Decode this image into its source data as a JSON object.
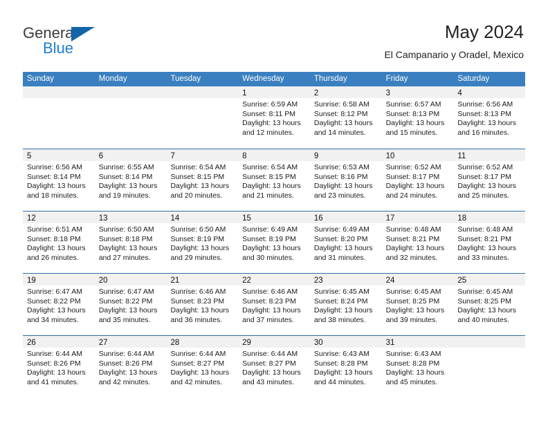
{
  "brand": {
    "name_top": "General",
    "name_bottom": "Blue",
    "flag_color": "#1464aa",
    "blue_text_color": "#1b7fd4"
  },
  "header": {
    "title": "May 2024",
    "subtitle": "El Campanario y Oradel, Mexico"
  },
  "theme": {
    "header_blue": "#3a7fbf",
    "row_divider_blue": "#2e6da4",
    "day_band_gray": "#f1f1f1"
  },
  "weekdays": [
    "Sunday",
    "Monday",
    "Tuesday",
    "Wednesday",
    "Thursday",
    "Friday",
    "Saturday"
  ],
  "weeks": [
    [
      {
        "day": "",
        "empty": true
      },
      {
        "day": "",
        "empty": true
      },
      {
        "day": "",
        "empty": true
      },
      {
        "day": "1",
        "sunrise": "Sunrise: 6:59 AM",
        "sunset": "Sunset: 8:11 PM",
        "daylight1": "Daylight: 13 hours",
        "daylight2": "and 12 minutes."
      },
      {
        "day": "2",
        "sunrise": "Sunrise: 6:58 AM",
        "sunset": "Sunset: 8:12 PM",
        "daylight1": "Daylight: 13 hours",
        "daylight2": "and 14 minutes."
      },
      {
        "day": "3",
        "sunrise": "Sunrise: 6:57 AM",
        "sunset": "Sunset: 8:13 PM",
        "daylight1": "Daylight: 13 hours",
        "daylight2": "and 15 minutes."
      },
      {
        "day": "4",
        "sunrise": "Sunrise: 6:56 AM",
        "sunset": "Sunset: 8:13 PM",
        "daylight1": "Daylight: 13 hours",
        "daylight2": "and 16 minutes."
      }
    ],
    [
      {
        "day": "5",
        "sunrise": "Sunrise: 6:56 AM",
        "sunset": "Sunset: 8:14 PM",
        "daylight1": "Daylight: 13 hours",
        "daylight2": "and 18 minutes."
      },
      {
        "day": "6",
        "sunrise": "Sunrise: 6:55 AM",
        "sunset": "Sunset: 8:14 PM",
        "daylight1": "Daylight: 13 hours",
        "daylight2": "and 19 minutes."
      },
      {
        "day": "7",
        "sunrise": "Sunrise: 6:54 AM",
        "sunset": "Sunset: 8:15 PM",
        "daylight1": "Daylight: 13 hours",
        "daylight2": "and 20 minutes."
      },
      {
        "day": "8",
        "sunrise": "Sunrise: 6:54 AM",
        "sunset": "Sunset: 8:15 PM",
        "daylight1": "Daylight: 13 hours",
        "daylight2": "and 21 minutes."
      },
      {
        "day": "9",
        "sunrise": "Sunrise: 6:53 AM",
        "sunset": "Sunset: 8:16 PM",
        "daylight1": "Daylight: 13 hours",
        "daylight2": "and 23 minutes."
      },
      {
        "day": "10",
        "sunrise": "Sunrise: 6:52 AM",
        "sunset": "Sunset: 8:17 PM",
        "daylight1": "Daylight: 13 hours",
        "daylight2": "and 24 minutes."
      },
      {
        "day": "11",
        "sunrise": "Sunrise: 6:52 AM",
        "sunset": "Sunset: 8:17 PM",
        "daylight1": "Daylight: 13 hours",
        "daylight2": "and 25 minutes."
      }
    ],
    [
      {
        "day": "12",
        "sunrise": "Sunrise: 6:51 AM",
        "sunset": "Sunset: 8:18 PM",
        "daylight1": "Daylight: 13 hours",
        "daylight2": "and 26 minutes."
      },
      {
        "day": "13",
        "sunrise": "Sunrise: 6:50 AM",
        "sunset": "Sunset: 8:18 PM",
        "daylight1": "Daylight: 13 hours",
        "daylight2": "and 27 minutes."
      },
      {
        "day": "14",
        "sunrise": "Sunrise: 6:50 AM",
        "sunset": "Sunset: 8:19 PM",
        "daylight1": "Daylight: 13 hours",
        "daylight2": "and 29 minutes."
      },
      {
        "day": "15",
        "sunrise": "Sunrise: 6:49 AM",
        "sunset": "Sunset: 8:19 PM",
        "daylight1": "Daylight: 13 hours",
        "daylight2": "and 30 minutes."
      },
      {
        "day": "16",
        "sunrise": "Sunrise: 6:49 AM",
        "sunset": "Sunset: 8:20 PM",
        "daylight1": "Daylight: 13 hours",
        "daylight2": "and 31 minutes."
      },
      {
        "day": "17",
        "sunrise": "Sunrise: 6:48 AM",
        "sunset": "Sunset: 8:21 PM",
        "daylight1": "Daylight: 13 hours",
        "daylight2": "and 32 minutes."
      },
      {
        "day": "18",
        "sunrise": "Sunrise: 6:48 AM",
        "sunset": "Sunset: 8:21 PM",
        "daylight1": "Daylight: 13 hours",
        "daylight2": "and 33 minutes."
      }
    ],
    [
      {
        "day": "19",
        "sunrise": "Sunrise: 6:47 AM",
        "sunset": "Sunset: 8:22 PM",
        "daylight1": "Daylight: 13 hours",
        "daylight2": "and 34 minutes."
      },
      {
        "day": "20",
        "sunrise": "Sunrise: 6:47 AM",
        "sunset": "Sunset: 8:22 PM",
        "daylight1": "Daylight: 13 hours",
        "daylight2": "and 35 minutes."
      },
      {
        "day": "21",
        "sunrise": "Sunrise: 6:46 AM",
        "sunset": "Sunset: 8:23 PM",
        "daylight1": "Daylight: 13 hours",
        "daylight2": "and 36 minutes."
      },
      {
        "day": "22",
        "sunrise": "Sunrise: 6:46 AM",
        "sunset": "Sunset: 8:23 PM",
        "daylight1": "Daylight: 13 hours",
        "daylight2": "and 37 minutes."
      },
      {
        "day": "23",
        "sunrise": "Sunrise: 6:45 AM",
        "sunset": "Sunset: 8:24 PM",
        "daylight1": "Daylight: 13 hours",
        "daylight2": "and 38 minutes."
      },
      {
        "day": "24",
        "sunrise": "Sunrise: 6:45 AM",
        "sunset": "Sunset: 8:25 PM",
        "daylight1": "Daylight: 13 hours",
        "daylight2": "and 39 minutes."
      },
      {
        "day": "25",
        "sunrise": "Sunrise: 6:45 AM",
        "sunset": "Sunset: 8:25 PM",
        "daylight1": "Daylight: 13 hours",
        "daylight2": "and 40 minutes."
      }
    ],
    [
      {
        "day": "26",
        "sunrise": "Sunrise: 6:44 AM",
        "sunset": "Sunset: 8:26 PM",
        "daylight1": "Daylight: 13 hours",
        "daylight2": "and 41 minutes."
      },
      {
        "day": "27",
        "sunrise": "Sunrise: 6:44 AM",
        "sunset": "Sunset: 8:26 PM",
        "daylight1": "Daylight: 13 hours",
        "daylight2": "and 42 minutes."
      },
      {
        "day": "28",
        "sunrise": "Sunrise: 6:44 AM",
        "sunset": "Sunset: 8:27 PM",
        "daylight1": "Daylight: 13 hours",
        "daylight2": "and 42 minutes."
      },
      {
        "day": "29",
        "sunrise": "Sunrise: 6:44 AM",
        "sunset": "Sunset: 8:27 PM",
        "daylight1": "Daylight: 13 hours",
        "daylight2": "and 43 minutes."
      },
      {
        "day": "30",
        "sunrise": "Sunrise: 6:43 AM",
        "sunset": "Sunset: 8:28 PM",
        "daylight1": "Daylight: 13 hours",
        "daylight2": "and 44 minutes."
      },
      {
        "day": "31",
        "sunrise": "Sunrise: 6:43 AM",
        "sunset": "Sunset: 8:28 PM",
        "daylight1": "Daylight: 13 hours",
        "daylight2": "and 45 minutes."
      },
      {
        "day": "",
        "empty": true
      }
    ]
  ]
}
